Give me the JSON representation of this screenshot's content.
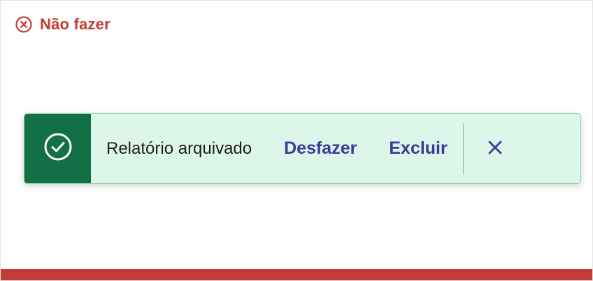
{
  "guideline": {
    "label": "Não fazer",
    "icon": "x-circle-icon",
    "color": "#c43b33"
  },
  "toast": {
    "icon": "check-circle-icon",
    "message": "Relatório arquivado",
    "undo_label": "Desfazer",
    "delete_label": "Excluir",
    "close_icon": "close-icon",
    "accent_color": "#127044",
    "background_color": "#ddf6ea",
    "action_color": "#3a3b97"
  }
}
